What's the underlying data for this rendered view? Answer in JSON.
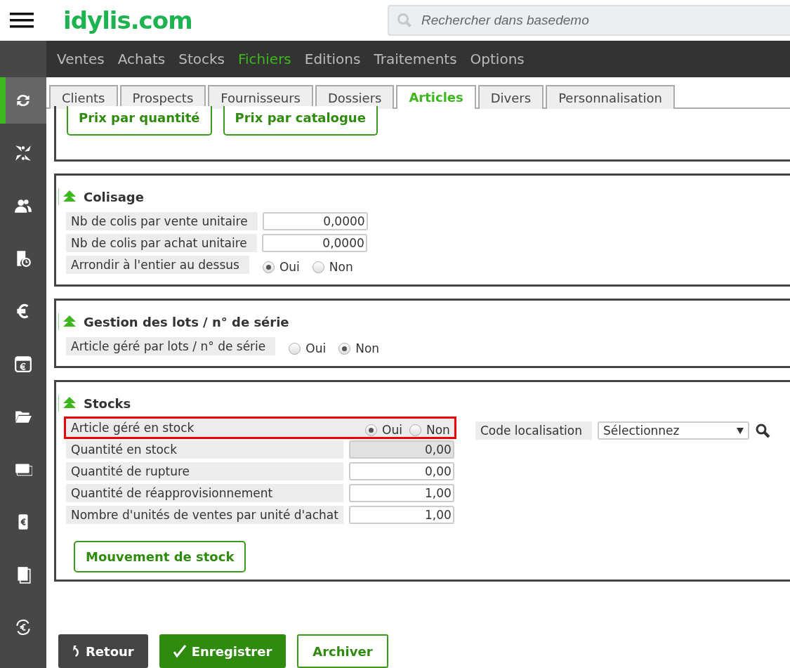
{
  "header": {
    "logo": "idylis.com",
    "search": {
      "placeholder": "Rechercher dans basedemo"
    }
  },
  "sidebar": {
    "items": [
      {
        "selected": true
      },
      {
        "selected": false
      },
      {
        "selected": false
      },
      {
        "selected": false
      },
      {
        "selected": false
      },
      {
        "selected": false
      },
      {
        "selected": false
      },
      {
        "selected": false
      },
      {
        "selected": false
      },
      {
        "selected": false
      },
      {
        "selected": false
      }
    ]
  },
  "menu": [
    {
      "label": "Ventes",
      "selected": false
    },
    {
      "label": "Achats",
      "selected": false
    },
    {
      "label": "Stocks",
      "selected": false
    },
    {
      "label": "Fichiers",
      "selected": true
    },
    {
      "label": "Editions",
      "selected": false
    },
    {
      "label": "Traitements",
      "selected": false
    },
    {
      "label": "Options",
      "selected": false
    }
  ],
  "tabs": [
    {
      "label": "Clients",
      "selected": false
    },
    {
      "label": "Prospects",
      "selected": false
    },
    {
      "label": "Fournisseurs",
      "selected": false
    },
    {
      "label": "Dossiers",
      "selected": false
    },
    {
      "label": "Articles",
      "selected": true
    },
    {
      "label": "Divers",
      "selected": false
    },
    {
      "label": "Personnalisation",
      "selected": false
    }
  ],
  "pricing_buttons": [
    "Prix par quantité",
    "Prix par catalogue"
  ],
  "sections": [
    {
      "title": "Colisage",
      "fields": [
        {
          "kind": "number",
          "label": "Nb de colis par vente unitaire",
          "value": "0,0000",
          "disabled": false
        },
        {
          "kind": "number",
          "label": "Nb de colis par achat unitaire",
          "value": "0,0000",
          "disabled": false
        },
        {
          "kind": "radio",
          "label": "Arrondir à l'entier au dessus",
          "options": [
            {
              "label": "Oui",
              "selected": true
            },
            {
              "label": "Non",
              "selected": false
            }
          ]
        }
      ]
    },
    {
      "title": "Gestion des lots / n° de série",
      "fields": [
        {
          "kind": "radio",
          "label": "Article géré par lots / n° de série",
          "options": [
            {
              "label": "Oui",
              "selected": false
            },
            {
              "label": "Non",
              "selected": true
            }
          ]
        }
      ]
    },
    {
      "title": "Stocks",
      "fields": [
        {
          "kind": "radio",
          "label": "Article géré en stock",
          "highlighted": true,
          "options": [
            {
              "label": "Oui",
              "selected": true
            },
            {
              "label": "Non",
              "selected": false
            }
          ]
        },
        {
          "kind": "number",
          "label": "Quantité en stock",
          "value": "0,00",
          "disabled": true
        },
        {
          "kind": "number",
          "label": "Quantité de rupture",
          "value": "0,00",
          "disabled": false
        },
        {
          "kind": "number",
          "label": "Quantité de réapprovisionnement",
          "value": "1,00",
          "disabled": false
        },
        {
          "kind": "number",
          "label": "Nombre d'unités de ventes par unité d'achat",
          "value": "1,00",
          "disabled": false
        }
      ],
      "location": {
        "label": "Code localisation",
        "value": "Sélectionnez"
      },
      "buttons": [
        "Mouvement de stock"
      ]
    }
  ],
  "footer": {
    "buttons": [
      {
        "kind": "back",
        "label": "Retour"
      },
      {
        "kind": "save",
        "label": "Enregistrer"
      },
      {
        "kind": "outline",
        "label": "Archiver"
      }
    ]
  }
}
